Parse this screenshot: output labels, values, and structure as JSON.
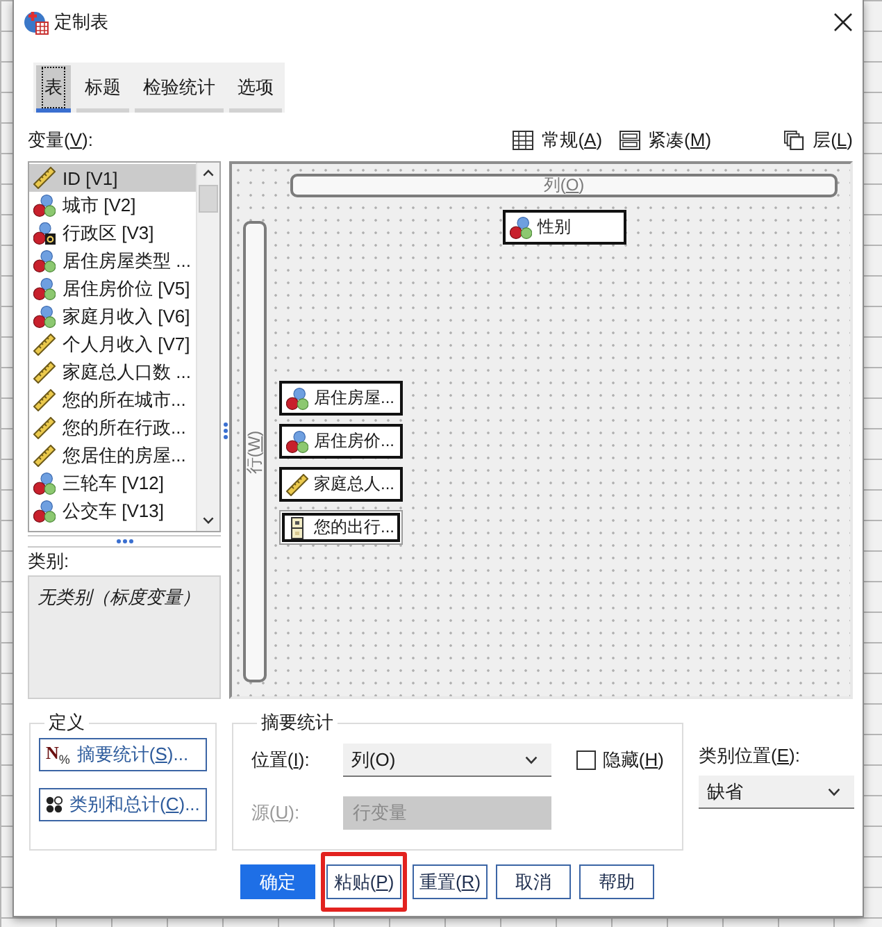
{
  "window": {
    "title": "定制表"
  },
  "tabs": [
    {
      "label": "表",
      "selected": true
    },
    {
      "label": "标题",
      "selected": false
    },
    {
      "label": "检验统计",
      "selected": false
    },
    {
      "label": "选项",
      "selected": false
    }
  ],
  "variables": {
    "label": "变量(V):",
    "items": [
      {
        "name": "ID [V1]",
        "kind": "scale",
        "selected": true
      },
      {
        "name": "城市 [V2]",
        "kind": "nominal",
        "selected": false
      },
      {
        "name": "行政区 [V3]",
        "kind": "nominal_string",
        "selected": false
      },
      {
        "name": "居住房屋类型 ...",
        "kind": "nominal",
        "selected": false
      },
      {
        "name": "居住房价位 [V5]",
        "kind": "nominal",
        "selected": false
      },
      {
        "name": "家庭月收入 [V6]",
        "kind": "nominal",
        "selected": false
      },
      {
        "name": "个人月收入 [V7]",
        "kind": "scale",
        "selected": false
      },
      {
        "name": "家庭总人口数 ...",
        "kind": "scale",
        "selected": false
      },
      {
        "name": "您的所在城市...",
        "kind": "scale",
        "selected": false
      },
      {
        "name": "您的所在行政...",
        "kind": "scale",
        "selected": false
      },
      {
        "name": "您居住的房屋...",
        "kind": "scale",
        "selected": false
      },
      {
        "name": "三轮车 [V12]",
        "kind": "nominal",
        "selected": false
      },
      {
        "name": "公交车 [V13]",
        "kind": "nominal",
        "selected": false
      }
    ]
  },
  "view_options": [
    {
      "label": "常规(A)",
      "kind": "standard"
    },
    {
      "label": "紧凑(M)",
      "kind": "compact"
    },
    {
      "label": "层(L)",
      "kind": "layers"
    }
  ],
  "categories": {
    "label": "类别:",
    "text": "无类别（标度变量）"
  },
  "canvas": {
    "column_label": "列(O)",
    "row_label": "行(W)",
    "column_variables": [
      {
        "name": "性别",
        "kind": "nominal",
        "focused": false
      }
    ],
    "row_variables": [
      {
        "name": "居住房屋...",
        "kind": "nominal",
        "focused": false
      },
      {
        "name": "居住房价...",
        "kind": "nominal",
        "focused": false
      },
      {
        "name": "家庭总人...",
        "kind": "scale",
        "focused": false
      },
      {
        "name": "您的出行...",
        "kind": "set",
        "focused": true
      }
    ]
  },
  "define": {
    "title": "定义",
    "buttons": [
      {
        "label": "摘要统计(S)...",
        "kind": "summary",
        "glyph": "N$_{%}$"
      },
      {
        "label": "类别和总计(C)...",
        "kind": "categories"
      }
    ]
  },
  "summary": {
    "title": "摘要统计",
    "position": {
      "label": "位置(I):",
      "value": "列(O)"
    },
    "hide": {
      "label": "隐藏(H)",
      "checked": false
    },
    "source": {
      "label": "源(U):",
      "value": "行变量",
      "disabled": true
    }
  },
  "category_position": {
    "label": "类别位置(E):",
    "value": "缺省"
  },
  "buttons": [
    {
      "label": "确定",
      "kind": "primary",
      "highlighted": false
    },
    {
      "label": "粘贴(P)",
      "kind": "default",
      "highlighted": true
    },
    {
      "label": "重置(R)",
      "kind": "default",
      "highlighted": false
    },
    {
      "label": "取消",
      "kind": "default",
      "highlighted": false
    },
    {
      "label": "帮助",
      "kind": "default",
      "highlighted": false
    }
  ]
}
